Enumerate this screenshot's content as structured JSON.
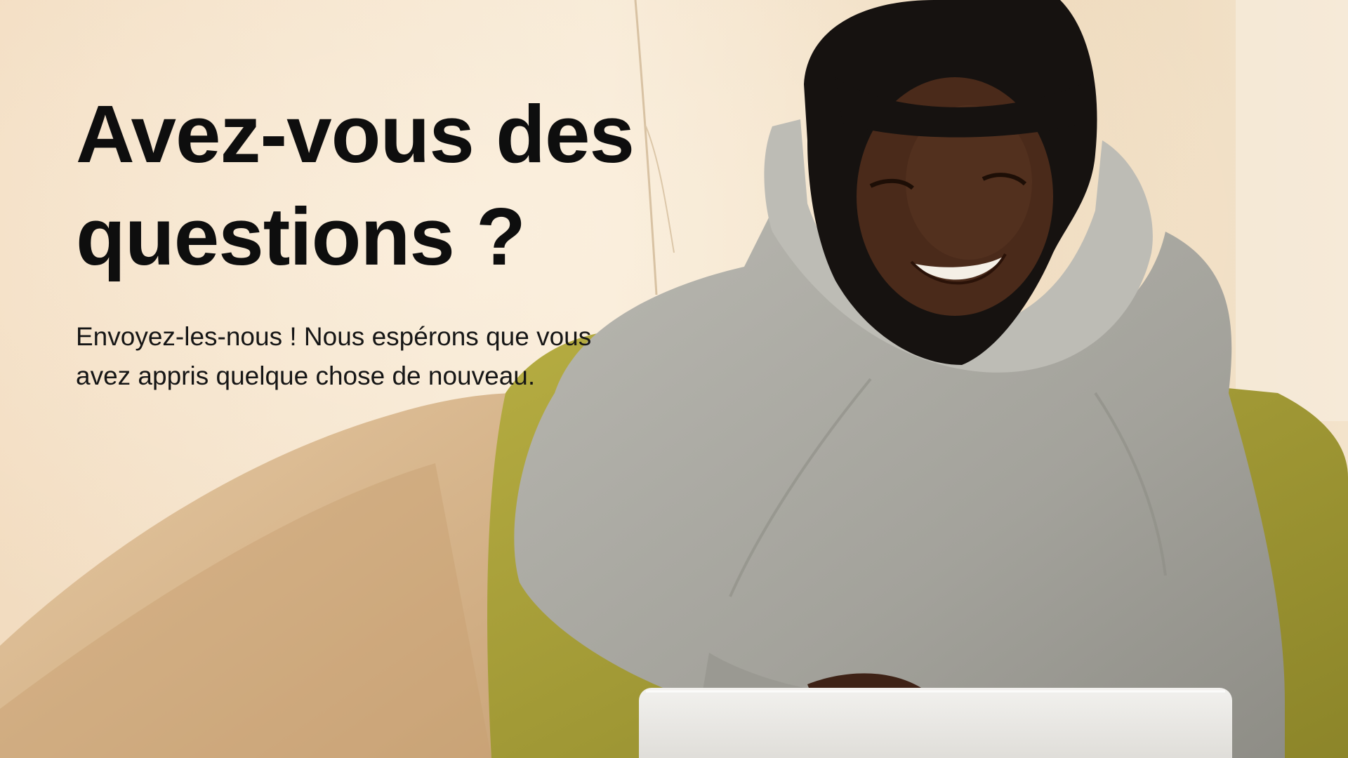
{
  "slide": {
    "title": "Avez-vous des questions ?",
    "subtitle": "Envoyez-les-nous ! Nous espérons que vous avez appris quelque chose de nouveau."
  },
  "photo": {
    "subject": "smiling-woman-with-laptop"
  },
  "colors": {
    "wall": "#f3dfc4",
    "sofa": "#ddb98f",
    "chair": "#a9a23a",
    "hoodie": "#a9a8a0",
    "hijab": "#161210",
    "skin": "#4a2a1a",
    "laptop": "#e8e6e2",
    "text": "#0e0e0e"
  }
}
